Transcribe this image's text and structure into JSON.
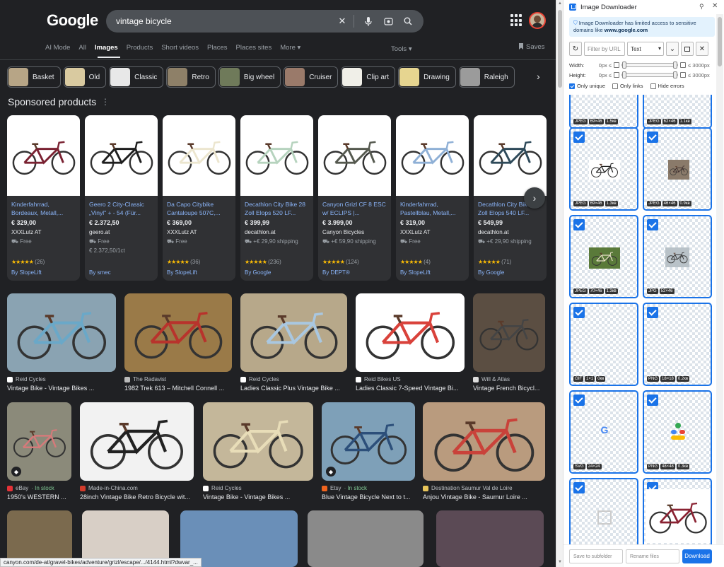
{
  "google": {
    "logo": "Google",
    "search_query": "vintage bicycle",
    "tabs": [
      "AI Mode",
      "All",
      "Images",
      "Products",
      "Short videos",
      "Places",
      "Places sites",
      "More ▾"
    ],
    "active_tab": "Images",
    "tools": "Tools ▾",
    "saves": "Saves",
    "chips": [
      {
        "label": "Basket",
        "color": "#b7a586"
      },
      {
        "label": "Old",
        "color": "#d9caa0"
      },
      {
        "label": "Classic",
        "color": "#e8e8e8"
      },
      {
        "label": "Retro",
        "color": "#8e8068"
      },
      {
        "label": "Big wheel",
        "color": "#6f7a5a"
      },
      {
        "label": "Cruiser",
        "color": "#9a7a6a"
      },
      {
        "label": "Clip art",
        "color": "#f0efe8"
      },
      {
        "label": "Drawing",
        "color": "#e6d590"
      },
      {
        "label": "Raleigh",
        "color": "#9b9b9b"
      }
    ],
    "sponsored_title": "Sponsored products",
    "products": [
      {
        "title": "Kinderfahrrad, Bordeaux, Metall,...",
        "price": "€ 329,00",
        "store": "XXXLutz AT",
        "shipping": "Free",
        "extra": "",
        "stars": "★★★★★",
        "count": "(26)",
        "by": "By SlopeLift",
        "frame": "#7a2232"
      },
      {
        "title": "Geero 2 City-Classic „Vinyl\" + - 54 (Für...",
        "price": "€ 2.372,50",
        "store": "geero.at",
        "shipping": "Free",
        "extra": "€ 2.372,50/1ct",
        "stars": "",
        "count": "",
        "by": "By smec",
        "frame": "#1e1e1e"
      },
      {
        "title": "Da Capo Citybike Cantaloupe 507C,...",
        "price": "€ 369,00",
        "store": "XXXLutz AT",
        "shipping": "Free",
        "extra": "",
        "stars": "★★★★★",
        "count": "(36)",
        "by": "By SlopeLift",
        "frame": "#ece6cf"
      },
      {
        "title": "Decathlon City Bike 28 Zoll Elops 520 LF...",
        "price": "€ 399,99",
        "store": "decathlon.at",
        "shipping": "+€ 29,90 shipping",
        "extra": "",
        "stars": "★★★★★",
        "count": "(236)",
        "by": "By Google",
        "frame": "#b6d3be"
      },
      {
        "title": "Canyon Grizl CF 8 ESC w/ ECLIPS |...",
        "price": "€ 3.999,00",
        "store": "Canyon Bicycles",
        "shipping": "+€ 59,90 shipping",
        "extra": "",
        "stars": "★★★★★",
        "count": "(124)",
        "by": "By DEPT®",
        "frame": "#55594f"
      },
      {
        "title": "Kinderfahrrad, Pastellblau, Metall,...",
        "price": "€ 319,00",
        "store": "XXXLutz AT",
        "shipping": "Free",
        "extra": "",
        "stars": "★★★★★",
        "count": "(4)",
        "by": "By SlopeLift",
        "frame": "#8fb0d6"
      },
      {
        "title": "Decathlon City Bike 28 Zoll Elops 540 LF...",
        "price": "€ 549,99",
        "store": "decathlon.at",
        "shipping": "+€ 29,90 shipping",
        "extra": "",
        "stars": "★★★★★",
        "count": "(71)",
        "by": "By Google",
        "frame": "#2e4a5a"
      }
    ],
    "row1": [
      {
        "source": "Reid Cycles",
        "title": "Vintage Bike - Vintage Bikes ...",
        "bg": "#8aa3b2",
        "frame": "#6aa8c8",
        "stock": "",
        "fav": "#ffffff"
      },
      {
        "source": "The Radavist",
        "title": "1982 Trek 613 – Mitchell Connell ...",
        "bg": "#9a7a48",
        "frame": "#b8332c",
        "stock": "",
        "fav": "#bbbbbb"
      },
      {
        "source": "Reid Cycles",
        "title": "Ladies Classic Plus Vintage Bike ...",
        "bg": "#b7a88a",
        "frame": "#a9c7e0",
        "stock": "",
        "fav": "#ffffff"
      },
      {
        "source": "Reid Bikes US",
        "title": "Ladies Classic 7-Speed Vintage Bi...",
        "bg": "#ffffff",
        "frame": "#d9423b",
        "stock": "",
        "fav": "#ffffff"
      },
      {
        "source": "Will & Atlas",
        "title": "Vintage French Bicycl...",
        "bg": "#5b4e42",
        "frame": "#444444",
        "stock": "",
        "fav": "#dddddd"
      }
    ],
    "row2": [
      {
        "source": "eBay",
        "title": "1950's WESTERN ...",
        "bg": "#8b8a7a",
        "frame": "#d57a7a",
        "stock": "In stock",
        "fav": "#e53238",
        "badge": true
      },
      {
        "source": "Made-in-China.com",
        "title": "28inch Vintage Bike Retro Bicycle wit...",
        "bg": "#f2f2f2",
        "frame": "#222222",
        "stock": "",
        "fav": "#d23b2b"
      },
      {
        "source": "Reid Cycles",
        "title": "Vintage Bike - Vintage Bikes ...",
        "bg": "#c4b79a",
        "frame": "#e8ddb8",
        "stock": "",
        "fav": "#ffffff"
      },
      {
        "source": "Etsy",
        "title": "Blue Vintage Bicycle Next to t...",
        "bg": "#7ea0b8",
        "frame": "#2c4f7a",
        "stock": "In stock",
        "fav": "#f1641e",
        "badge": true
      },
      {
        "source": "Destination Saumur Val de Loire",
        "title": "Anjou Vintage Bike - Saumur Loire ...",
        "bg": "#b99b7e",
        "frame": "#c9423a",
        "stock": "",
        "fav": "#e8c55a"
      }
    ],
    "row3": [
      {
        "bg": "#7b6a4e"
      },
      {
        "bg": "#d8cfc6"
      },
      {
        "bg": "#6a8fb8"
      },
      {
        "bg": "#8a8a8a"
      },
      {
        "bg": "#5b4a55"
      }
    ],
    "status_url": "canyon.com/de-at/gravel-bikes/adventure/grizl/escape/.../4144.html?dwvar_..."
  },
  "extension": {
    "title": "Image Downloader",
    "notice_text": "Image Downloader has limited access to sensitive domains like",
    "notice_domain": "www.google.com",
    "filter_placeholder": "Filter by URL",
    "filter_mode": "Text",
    "width_label": "Width:",
    "height_label": "Height:",
    "min_label": "0px ≤",
    "max_label": "≤ 3000px",
    "only_unique": "Only unique",
    "only_links": "Only links",
    "hide_errors": "Hide errors",
    "tiles": [
      {
        "type": "JPEG",
        "dims": "69×46",
        "size": "1.5кв",
        "img": "none"
      },
      {
        "type": "JPEG",
        "dims": "62×46",
        "size": "1.1кв",
        "img": "none"
      },
      {
        "type": "JPEG",
        "dims": "69×46",
        "size": "1.3кв",
        "img": "bike-black"
      },
      {
        "type": "JPEG",
        "dims": "46×46",
        "size": "0.9кв",
        "img": "bike-photo"
      },
      {
        "type": "JPEG",
        "dims": "70×46",
        "size": "1.3кв",
        "img": "bike-grass"
      },
      {
        "type": "JPG",
        "dims": "52×46",
        "size": "",
        "img": "bike-photo2"
      },
      {
        "type": "GIF",
        "dims": "1×1",
        "size": "0кв",
        "img": "none"
      },
      {
        "type": "PNG",
        "dims": "18×18",
        "size": "0.2кв",
        "img": "none"
      },
      {
        "type": "SVG",
        "dims": "24×24",
        "size": "",
        "img": "google-g"
      },
      {
        "type": "PNG",
        "dims": "48×48",
        "size": "0.3кв",
        "img": "lens"
      },
      {
        "type": "",
        "dims": "",
        "size": "",
        "img": "broken"
      },
      {
        "type": "",
        "dims": "",
        "size": "",
        "img": "bike-red"
      }
    ],
    "save_subfolder": "Save to subfolder",
    "rename_files": "Rename files",
    "download": "Download"
  }
}
